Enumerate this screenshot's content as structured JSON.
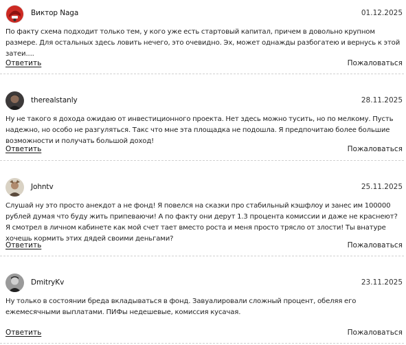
{
  "comments": [
    {
      "author": "Виктор Naga",
      "date": "01.12.2025",
      "avatar": "avatar-red-helmet",
      "text": "По факту схема подходит только тем, у кого уже есть стартовый капитал, причем в довольно крупном размере. Для остальных здесь ловить нечего, это очевидно. Эх, может однажды разбогатею и вернусь к этой затеи....",
      "reply_label": "Ответить",
      "report_label": "Пожаловаться"
    },
    {
      "author": "therealstanly",
      "date": "28.11.2025",
      "avatar": "avatar-portrait-dark",
      "text": "Ну не такого я дохода ожидаю от инвестиционного проекта. Нет здесь можно тусить, но по мелкому. Пусть надежно, но особо не разгуляться. Такс что мне эта площадка не подошла. Я предпочитаю более большие возможности и получать большой доход!",
      "reply_label": "Ответить",
      "report_label": "Пожаловаться"
    },
    {
      "author": "Johntv",
      "date": "25.11.2025",
      "avatar": "avatar-portrait-light",
      "text": "Слушай ну это просто анекдот а не фонд! Я повелся на сказки про стабильный кэшфлоу и занес им 100000 рублей думая что буду жить припеваючи! А по факту они дерут 1.3 процента комиссии и даже не краснеют? Я смотрел в личном кабинете как мой счет тает вместо роста и меня просто трясло от злости! Ты внатуре хочешь кормить этих дядей своими деньгами?",
      "reply_label": "Ответить",
      "report_label": "Пожаловаться"
    },
    {
      "author": "DmitryKv",
      "date": "23.11.2025",
      "avatar": "avatar-portrait-bw",
      "text": "Ну только в состоянии бреда вкладываться в фонд. Завуалировали сложный процент, обеляя его ежемесячными выплатами. ПИФы недешевые, комиссия кусачая.",
      "reply_label": "Ответить",
      "report_label": "Пожаловаться"
    }
  ]
}
